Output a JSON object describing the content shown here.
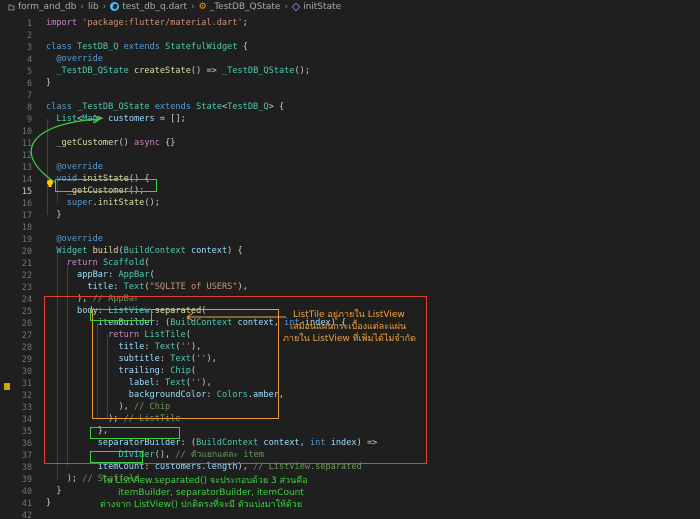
{
  "breadcrumb": {
    "folder": "form_and_db",
    "subfolder": "lib",
    "file": "test_db_q.dart",
    "class": "_TestDB_QState",
    "method": "initState"
  },
  "lines": [
    {
      "n": "1",
      "t": "import 'package:flutter/material.dart';"
    },
    {
      "n": "2",
      "t": ""
    },
    {
      "n": "3",
      "t": "class TestDB_Q extends StatefulWidget {"
    },
    {
      "n": "4",
      "t": "  @override"
    },
    {
      "n": "5",
      "t": "  _TestDB_QState createState() => _TestDB_QState();"
    },
    {
      "n": "6",
      "t": "}"
    },
    {
      "n": "7",
      "t": ""
    },
    {
      "n": "8",
      "t": "class _TestDB_QState extends State<TestDB_Q> {"
    },
    {
      "n": "9",
      "t": "  List<Map> customers = [];"
    },
    {
      "n": "10",
      "t": ""
    },
    {
      "n": "11",
      "t": "  _getCustomer() async {}"
    },
    {
      "n": "12",
      "t": ""
    },
    {
      "n": "13",
      "t": "  @override"
    },
    {
      "n": "14",
      "t": "  void initState() {"
    },
    {
      "n": "15",
      "t": "    _getCustomer();"
    },
    {
      "n": "16",
      "t": "    super.initState();"
    },
    {
      "n": "17",
      "t": "  }"
    },
    {
      "n": "18",
      "t": ""
    },
    {
      "n": "19",
      "t": "  @override"
    },
    {
      "n": "20",
      "t": "  Widget build(BuildContext context) {"
    },
    {
      "n": "21",
      "t": "    return Scaffold("
    },
    {
      "n": "22",
      "t": "      appBar: AppBar("
    },
    {
      "n": "23",
      "t": "        title: Text(\"SQLITE of USERS\"),"
    },
    {
      "n": "24",
      "t": "      ), // AppBar"
    },
    {
      "n": "25",
      "t": "      body: ListView.separated("
    },
    {
      "n": "26",
      "t": "          itemBuilder: (BuildContext context, int index) {"
    },
    {
      "n": "27",
      "t": "            return ListTile("
    },
    {
      "n": "28",
      "t": "              title: Text(''),"
    },
    {
      "n": "29",
      "t": "              subtitle: Text(''),"
    },
    {
      "n": "30",
      "t": "              trailing: Chip("
    },
    {
      "n": "31",
      "t": "                label: Text(''),"
    },
    {
      "n": "32",
      "t": "                backgroundColor: Colors.amber,"
    },
    {
      "n": "33",
      "t": "              ), // Chip"
    },
    {
      "n": "34",
      "t": "            ); // ListTile"
    },
    {
      "n": "35",
      "t": "          },"
    },
    {
      "n": "36",
      "t": "          separatorBuilder: (BuildContext context, int index) =>"
    },
    {
      "n": "37",
      "t": "              Divider(), // ตัวแยกแต่ละ item"
    },
    {
      "n": "38",
      "t": "          itemCount: customers.length), // ListView.separated"
    },
    {
      "n": "39",
      "t": "    ); // Scaffold"
    },
    {
      "n": "40",
      "t": "  }"
    },
    {
      "n": "41",
      "t": "}"
    },
    {
      "n": "42",
      "t": ""
    }
  ],
  "annotations": {
    "listtile_note_1": "ListTile อยู่ภายใน ListView",
    "listtile_note_2": "เสมือนแผ่นกระเบื้องแต่ละแผ่น",
    "listtile_note_3": "ภายใน ListView ที่เพิ่มได้ไม่จำกัด",
    "bottom_note_1": "ใน ListView.separated() จะประกอบด้วย 3 ส่วนคือ",
    "bottom_note_2": "itemBuilder, separatorBuilder, itemCount",
    "bottom_note_3": "ต่างจาก ListView() ปกติตรงที่จะมี ตัวแบ่งมาให้ด้วย"
  },
  "colors": {
    "red_box": "#e04030",
    "orange_box": "#e89a3c",
    "green_box": "#3fd13f",
    "note_green": "#3fd13f",
    "note_orange": "#f2a33a"
  }
}
